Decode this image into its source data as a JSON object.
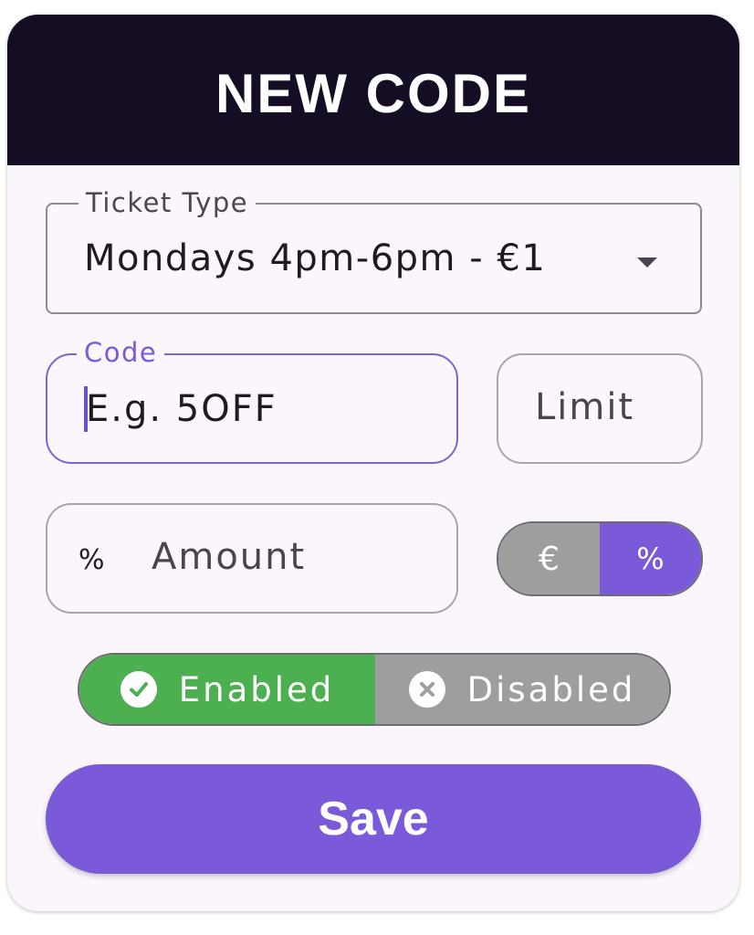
{
  "header": {
    "title": "NEW CODE"
  },
  "ticket_type": {
    "label": "Ticket Type",
    "value": "Mondays 4pm-6pm - €1"
  },
  "code": {
    "label": "Code",
    "placeholder": "E.g. 5OFF"
  },
  "limit": {
    "placeholder": "Limit"
  },
  "amount": {
    "prefix": "%",
    "placeholder": "Amount"
  },
  "discount_type_toggle": {
    "options": [
      "€",
      "%"
    ],
    "selected": "%"
  },
  "status_toggle": {
    "enabled_label": "Enabled",
    "disabled_label": "Disabled",
    "selected": "Enabled"
  },
  "save_button": {
    "label": "Save"
  },
  "colors": {
    "header_bg": "#150d24",
    "accent": "#7a5ad9",
    "enabled_green": "#4caf50",
    "inactive_gray": "#9e9e9e"
  },
  "icons": {
    "dropdown": "arrow-drop-down-icon",
    "enabled": "check-circle-icon",
    "disabled": "cancel-circle-icon"
  }
}
